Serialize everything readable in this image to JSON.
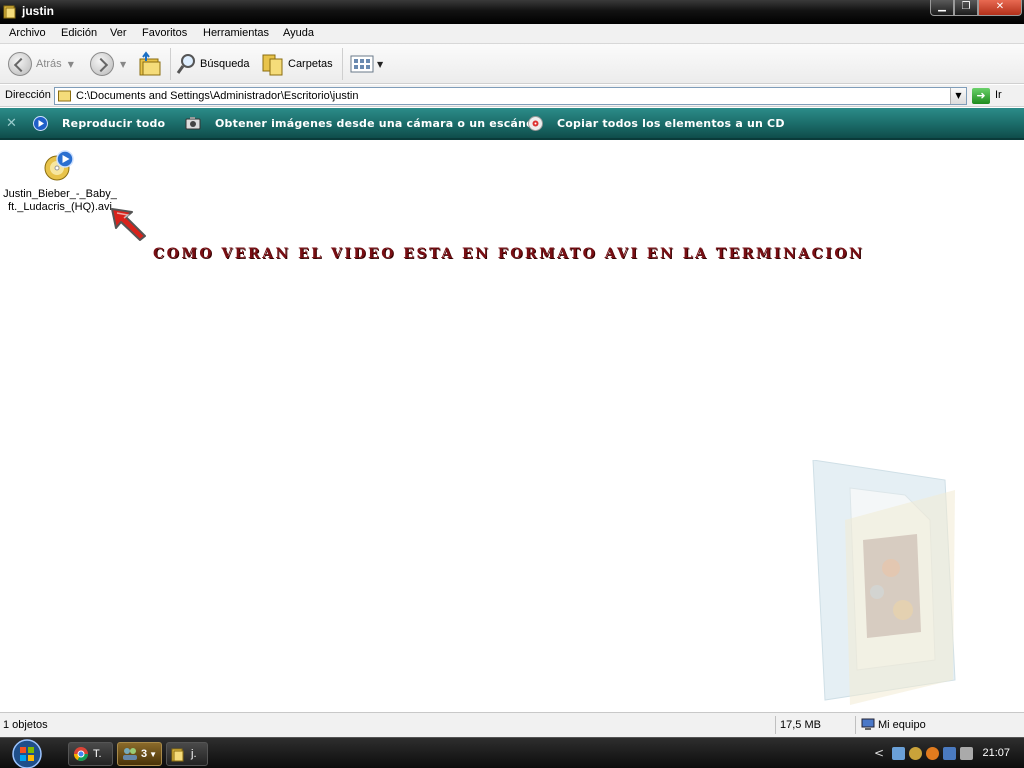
{
  "window": {
    "title": "justin",
    "buttons": {
      "minimize": "▁",
      "maximize": "❐",
      "close": "✕"
    }
  },
  "menu": [
    "Archivo",
    "Edición",
    "Ver",
    "Favoritos",
    "Herramientas",
    "Ayuda"
  ],
  "toolbar": {
    "back_label": "Atrás",
    "search_label": "Búsqueda",
    "folders_label": "Carpetas"
  },
  "address": {
    "label": "Dirección",
    "path": "C:\\Documents and Settings\\Administrador\\Escritorio\\justin",
    "go_label": "Ir",
    "go_glyph": "➜"
  },
  "tasks": {
    "close_glyph": "✕",
    "items": [
      {
        "label": "Reproducir todo",
        "icon": "play-icon"
      },
      {
        "label": "Obtener imágenes desde una cámara o un escáner",
        "icon": "camera-icon"
      },
      {
        "label": "Copiar todos los elementos a un CD",
        "icon": "cd-burn-icon"
      }
    ]
  },
  "files": [
    {
      "name_line1": "Justin_Bieber_-_Baby_",
      "name_line2": "ft._Ludacris_(HQ).avi",
      "icon": "media-cd-icon"
    }
  ],
  "annotation": {
    "text": "Como veran el video esta en formato avi en la terminacion",
    "color": "#7a0f14"
  },
  "status": {
    "objects": "1 objetos",
    "size": "17,5 MB",
    "location": "Mi equipo"
  },
  "taskbar": {
    "items": [
      {
        "label": "T."
      },
      {
        "label": "3"
      },
      {
        "label": "j."
      }
    ],
    "tray_chevron": "<",
    "clock": "21:07"
  },
  "colors": {
    "titlebar": "#121212",
    "taskpane": "#1c6e6b",
    "accent_green": "#1e8c1e"
  }
}
